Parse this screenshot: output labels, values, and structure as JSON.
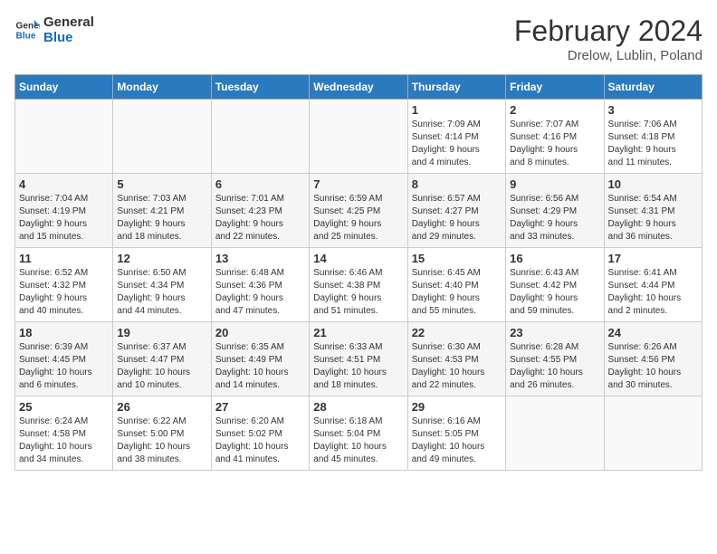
{
  "logo": {
    "line1": "General",
    "line2": "Blue"
  },
  "title": "February 2024",
  "subtitle": "Drelow, Lublin, Poland",
  "days_of_week": [
    "Sunday",
    "Monday",
    "Tuesday",
    "Wednesday",
    "Thursday",
    "Friday",
    "Saturday"
  ],
  "weeks": [
    [
      {
        "day": "",
        "info": ""
      },
      {
        "day": "",
        "info": ""
      },
      {
        "day": "",
        "info": ""
      },
      {
        "day": "",
        "info": ""
      },
      {
        "day": "1",
        "info": "Sunrise: 7:09 AM\nSunset: 4:14 PM\nDaylight: 9 hours\nand 4 minutes."
      },
      {
        "day": "2",
        "info": "Sunrise: 7:07 AM\nSunset: 4:16 PM\nDaylight: 9 hours\nand 8 minutes."
      },
      {
        "day": "3",
        "info": "Sunrise: 7:06 AM\nSunset: 4:18 PM\nDaylight: 9 hours\nand 11 minutes."
      }
    ],
    [
      {
        "day": "4",
        "info": "Sunrise: 7:04 AM\nSunset: 4:19 PM\nDaylight: 9 hours\nand 15 minutes."
      },
      {
        "day": "5",
        "info": "Sunrise: 7:03 AM\nSunset: 4:21 PM\nDaylight: 9 hours\nand 18 minutes."
      },
      {
        "day": "6",
        "info": "Sunrise: 7:01 AM\nSunset: 4:23 PM\nDaylight: 9 hours\nand 22 minutes."
      },
      {
        "day": "7",
        "info": "Sunrise: 6:59 AM\nSunset: 4:25 PM\nDaylight: 9 hours\nand 25 minutes."
      },
      {
        "day": "8",
        "info": "Sunrise: 6:57 AM\nSunset: 4:27 PM\nDaylight: 9 hours\nand 29 minutes."
      },
      {
        "day": "9",
        "info": "Sunrise: 6:56 AM\nSunset: 4:29 PM\nDaylight: 9 hours\nand 33 minutes."
      },
      {
        "day": "10",
        "info": "Sunrise: 6:54 AM\nSunset: 4:31 PM\nDaylight: 9 hours\nand 36 minutes."
      }
    ],
    [
      {
        "day": "11",
        "info": "Sunrise: 6:52 AM\nSunset: 4:32 PM\nDaylight: 9 hours\nand 40 minutes."
      },
      {
        "day": "12",
        "info": "Sunrise: 6:50 AM\nSunset: 4:34 PM\nDaylight: 9 hours\nand 44 minutes."
      },
      {
        "day": "13",
        "info": "Sunrise: 6:48 AM\nSunset: 4:36 PM\nDaylight: 9 hours\nand 47 minutes."
      },
      {
        "day": "14",
        "info": "Sunrise: 6:46 AM\nSunset: 4:38 PM\nDaylight: 9 hours\nand 51 minutes."
      },
      {
        "day": "15",
        "info": "Sunrise: 6:45 AM\nSunset: 4:40 PM\nDaylight: 9 hours\nand 55 minutes."
      },
      {
        "day": "16",
        "info": "Sunrise: 6:43 AM\nSunset: 4:42 PM\nDaylight: 9 hours\nand 59 minutes."
      },
      {
        "day": "17",
        "info": "Sunrise: 6:41 AM\nSunset: 4:44 PM\nDaylight: 10 hours\nand 2 minutes."
      }
    ],
    [
      {
        "day": "18",
        "info": "Sunrise: 6:39 AM\nSunset: 4:45 PM\nDaylight: 10 hours\nand 6 minutes."
      },
      {
        "day": "19",
        "info": "Sunrise: 6:37 AM\nSunset: 4:47 PM\nDaylight: 10 hours\nand 10 minutes."
      },
      {
        "day": "20",
        "info": "Sunrise: 6:35 AM\nSunset: 4:49 PM\nDaylight: 10 hours\nand 14 minutes."
      },
      {
        "day": "21",
        "info": "Sunrise: 6:33 AM\nSunset: 4:51 PM\nDaylight: 10 hours\nand 18 minutes."
      },
      {
        "day": "22",
        "info": "Sunrise: 6:30 AM\nSunset: 4:53 PM\nDaylight: 10 hours\nand 22 minutes."
      },
      {
        "day": "23",
        "info": "Sunrise: 6:28 AM\nSunset: 4:55 PM\nDaylight: 10 hours\nand 26 minutes."
      },
      {
        "day": "24",
        "info": "Sunrise: 6:26 AM\nSunset: 4:56 PM\nDaylight: 10 hours\nand 30 minutes."
      }
    ],
    [
      {
        "day": "25",
        "info": "Sunrise: 6:24 AM\nSunset: 4:58 PM\nDaylight: 10 hours\nand 34 minutes."
      },
      {
        "day": "26",
        "info": "Sunrise: 6:22 AM\nSunset: 5:00 PM\nDaylight: 10 hours\nand 38 minutes."
      },
      {
        "day": "27",
        "info": "Sunrise: 6:20 AM\nSunset: 5:02 PM\nDaylight: 10 hours\nand 41 minutes."
      },
      {
        "day": "28",
        "info": "Sunrise: 6:18 AM\nSunset: 5:04 PM\nDaylight: 10 hours\nand 45 minutes."
      },
      {
        "day": "29",
        "info": "Sunrise: 6:16 AM\nSunset: 5:05 PM\nDaylight: 10 hours\nand 49 minutes."
      },
      {
        "day": "",
        "info": ""
      },
      {
        "day": "",
        "info": ""
      }
    ]
  ]
}
